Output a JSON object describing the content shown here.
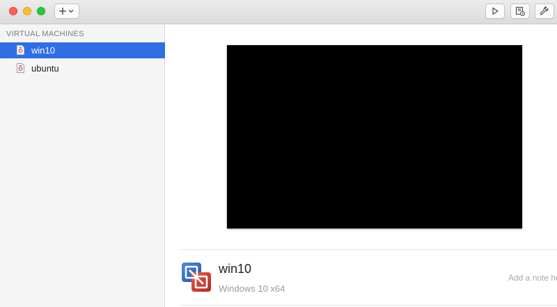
{
  "toolbar": {
    "add_icon": "plus-icon",
    "dropdown_icon": "chevron-down-icon",
    "play_icon": "play-icon",
    "snapshot_icon": "snapshot-icon",
    "settings_icon": "wrench-icon"
  },
  "sidebar": {
    "header": "VIRTUAL MACHINES",
    "items": [
      {
        "label": "win10",
        "icon": "vm-document-icon",
        "selected": true
      },
      {
        "label": "ubuntu",
        "icon": "vm-document-icon",
        "selected": false
      }
    ]
  },
  "details": {
    "name": "win10",
    "os": "Windows 10 x64",
    "note_placeholder": "Add a note he",
    "logo": "vmware-fusion-logo"
  },
  "colors": {
    "selection": "#2f6ee6",
    "screen": "#000000",
    "logo_blue": "#2a63c6",
    "logo_red": "#d23a2f"
  }
}
